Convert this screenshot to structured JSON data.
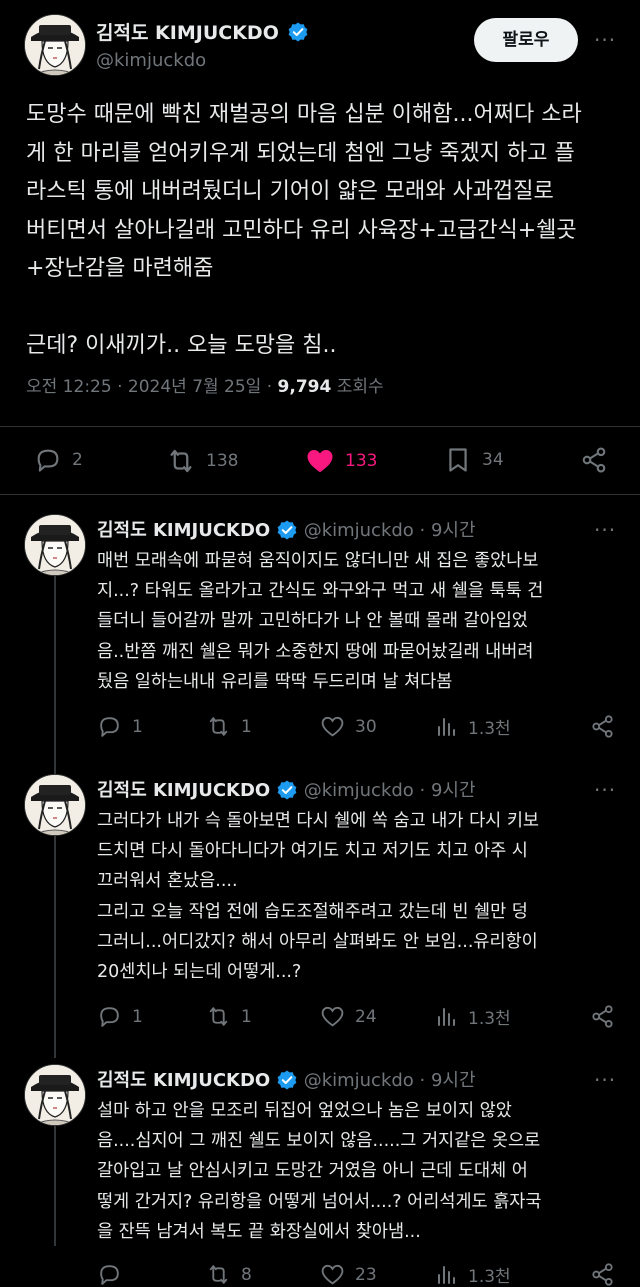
{
  "main": {
    "author_name": "김적도 KIMJUCKDO",
    "handle": "@kimjuckdo",
    "follow_label": "팔로우",
    "more_label": "···",
    "text_lines": [
      "도망수 때문에 빡친 재벌공의 마음 십분 이해함...어쩌다 소라",
      "게 한 마리를 얻어키우게 되었는데 첨엔 그냥 죽겠지 하고 플",
      "라스틱 통에 내버려뒀더니 기어이 얇은 모래와 사과껍질로",
      "버티면서 살아나길래 고민하다 유리 사육장+고급간식+쉘곳",
      "+장난감을 마련해줌",
      "",
      "근데? 이새끼가.. 오늘 도망을 침.."
    ],
    "timestamp": "오전 12:25 · 2024년 7월 25일 · ",
    "views_count": "9,794",
    "views_label": " 조회수",
    "stats": {
      "replies": "2",
      "retweets": "138",
      "likes": "133",
      "bookmarks": "34"
    },
    "like_color": "#f91880"
  },
  "replies": [
    {
      "author_name": "김적도 KIMJUCKDO",
      "handle": "@kimjuckdo · 9시간",
      "text_lines": [
        "매번 모래속에 파묻혀 움직이지도 않더니만 새 집은 좋았나보",
        "지...? 타워도 올라가고 간식도 와구와구 먹고 새 쉘을 툭툭 건",
        "들더니 들어갈까 말까 고민하다가 나 안 볼때 몰래 갈아입었",
        "음..반쯤 깨진 쉘은 뭐가 소중한지 땅에 파묻어놨길래 내버려",
        "뒀음 일하는내내 유리를 딱딱 두드리며 날 쳐다봄"
      ],
      "stats": {
        "replies": "1",
        "retweets": "1",
        "likes": "30",
        "views": "1.3천"
      }
    },
    {
      "author_name": "김적도 KIMJUCKDO",
      "handle": "@kimjuckdo · 9시간",
      "text_lines": [
        "그러다가 내가 슥 돌아보면 다시 쉘에 쏙 숨고 내가 다시 키보",
        "드치면 다시 돌아다니다가 여기도 치고 저기도 치고 아주 시",
        "끄러워서 혼났음....",
        "그리고 오늘 작업 전에 습도조절해주려고 갔는데 빈 쉘만 덩",
        "그러니...어디갔지? 해서 아무리 살펴봐도 안 보임...유리항이",
        "20센치나 되는데 어떻게...?"
      ],
      "stats": {
        "replies": "1",
        "retweets": "1",
        "likes": "24",
        "views": "1.3천"
      }
    },
    {
      "author_name": "김적도 KIMJUCKDO",
      "handle": "@kimjuckdo · 9시간",
      "text_lines": [
        "설마 하고 안을 모조리 뒤집어 엎었으나 놈은 보이지 않았",
        "음....심지어 그 깨진 쉘도 보이지 않음.....그 거지같은 옷으로",
        "갈아입고 날 안심시키고 도망간 거였음 아니 근데 도대체 어",
        "떻게 간거지? 유리항을 어떻게 넘어서....? 어리석게도 흙자국",
        "을 잔뜩 남겨서 복도 끝 화장실에서 찾아냄..."
      ],
      "stats": {
        "replies": "",
        "retweets": "8",
        "likes": "23",
        "views": "1.3천"
      }
    }
  ],
  "icons": {
    "verified": "verified-badge-icon",
    "reply": "reply-icon",
    "retweet": "retweet-icon",
    "like": "heart-icon",
    "bookmark": "bookmark-icon",
    "share": "share-icon",
    "views": "views-bar-icon"
  },
  "colors": {
    "verified": "#1d9bf0",
    "muted": "#71767b",
    "text": "#e7e9ea"
  }
}
